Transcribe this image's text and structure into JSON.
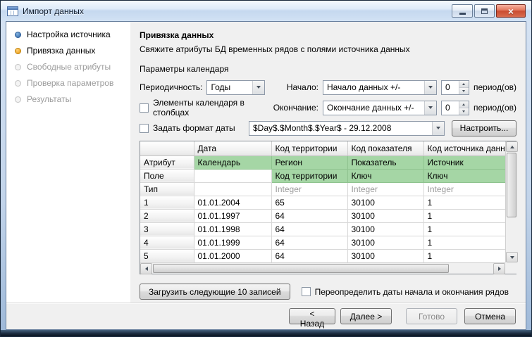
{
  "window": {
    "title": "Импорт данных"
  },
  "icons": {
    "close_glyph": "×"
  },
  "sidebar": {
    "items": [
      {
        "label": "Настройка источника"
      },
      {
        "label": "Привязка данных"
      },
      {
        "label": "Свободные атрибуты"
      },
      {
        "label": "Проверка параметров"
      },
      {
        "label": "Результаты"
      }
    ]
  },
  "content": {
    "heading": "Привязка данных",
    "subtitle": "Свяжите атрибуты БД временных рядов с полями источника данных",
    "calendar": {
      "group_label": "Параметры календаря",
      "periodicity_label": "Периодичность:",
      "periodicity_value": "Годы",
      "start_label": "Начало:",
      "start_value": "Начало данных +/-",
      "start_offset": "0",
      "start_periods_label": "период(ов)",
      "columns_checkbox_label": "Элементы календаря в столбцах",
      "end_label": "Окончание:",
      "end_value": "Окончание данных +/-",
      "end_offset": "0",
      "end_periods_label": "период(ов)",
      "date_format_checkbox_label": "Задать формат даты",
      "date_format_value": "$Day$.$Month$.$Year$ - 29.12.2008",
      "configure_button_label": "Настроить..."
    },
    "table": {
      "columns": [
        "",
        "Дата",
        "Код территории",
        "Код показателя",
        "Код источника данных"
      ],
      "meta_rows": [
        {
          "label": "Атрибут",
          "cells": [
            "Календарь",
            "Регион",
            "Показатель",
            "Источник"
          ]
        },
        {
          "label": "Поле",
          "cells": [
            "",
            "Код территории",
            "Ключ",
            "Ключ"
          ]
        },
        {
          "label": "Тип",
          "cells": [
            "",
            "Integer",
            "Integer",
            "Integer"
          ]
        }
      ],
      "data_rows": [
        {
          "label": "1",
          "cells": [
            "01.01.2004",
            "65",
            "30100",
            "1"
          ]
        },
        {
          "label": "2",
          "cells": [
            "01.01.1997",
            "64",
            "30100",
            "1"
          ]
        },
        {
          "label": "3",
          "cells": [
            "01.01.1998",
            "64",
            "30100",
            "1"
          ]
        },
        {
          "label": "4",
          "cells": [
            "01.01.1999",
            "64",
            "30100",
            "1"
          ]
        },
        {
          "label": "5",
          "cells": [
            "01.01.2000",
            "64",
            "30100",
            "1"
          ]
        }
      ]
    },
    "load_more_button_label": "Загрузить следующие 10 записей",
    "override_checkbox_label": "Переопределить даты начала и окончания рядов"
  },
  "footer": {
    "back_label": "< Назад",
    "next_label": "Далее >",
    "finish_label": "Готово",
    "cancel_label": "Отмена"
  }
}
